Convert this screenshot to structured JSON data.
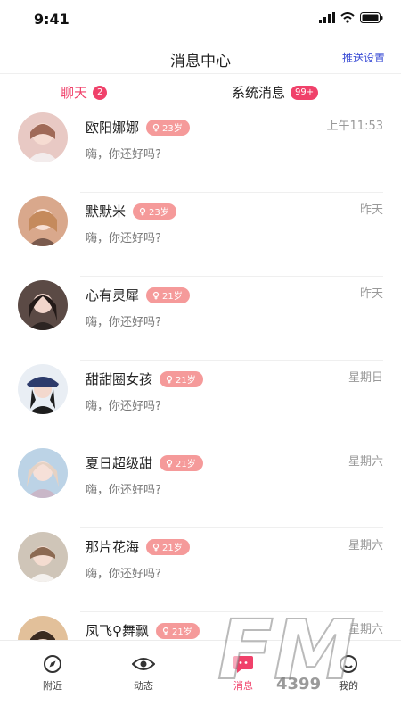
{
  "status_bar": {
    "time": "9:41"
  },
  "header": {
    "title": "消息中心",
    "push_settings": "推送设置"
  },
  "tabs": [
    {
      "label": "聊天",
      "badge": "2"
    },
    {
      "label": "系统消息",
      "badge": "99+"
    }
  ],
  "conversations": [
    {
      "name": "欧阳娜娜",
      "age": "23岁",
      "preview": "嗨，你还好吗?",
      "time": "上午11:53",
      "avatar_color": "#e8c9c4"
    },
    {
      "name": "默默米",
      "age": "23岁",
      "preview": "嗨，你还好吗?",
      "time": "昨天",
      "avatar_color": "#d9a88c"
    },
    {
      "name": "心有灵犀",
      "age": "21岁",
      "preview": "嗨，你还好吗?",
      "time": "昨天",
      "avatar_color": "#5b4a45"
    },
    {
      "name": "甜甜圈女孩",
      "age": "21岁",
      "preview": "嗨，你还好吗?",
      "time": "星期日",
      "avatar_color": "#2d3b6b"
    },
    {
      "name": "夏日超级甜",
      "age": "21岁",
      "preview": "嗨，你还好吗?",
      "time": "星期六",
      "avatar_color": "#c9b7c8"
    },
    {
      "name": "那片花海",
      "age": "21岁",
      "preview": "嗨，你还好吗?",
      "time": "星期六",
      "avatar_color": "#cfc5b8"
    },
    {
      "name": "凤飞♀舞飘",
      "age": "21岁",
      "preview": "",
      "time": "星期六",
      "avatar_color": "#e2c09a"
    }
  ],
  "bottom_nav": [
    {
      "label": "附近",
      "icon": "compass-icon"
    },
    {
      "label": "动态",
      "icon": "eye-icon"
    },
    {
      "label": "消息",
      "icon": "message-icon",
      "active": true
    },
    {
      "label": "我的",
      "icon": "profile-icon"
    }
  ],
  "watermark": {
    "text": "FM",
    "subtext": "4399"
  },
  "colors": {
    "accent": "#f0416a",
    "age_pill": "#f59a9a",
    "link": "#3d4fd6"
  }
}
